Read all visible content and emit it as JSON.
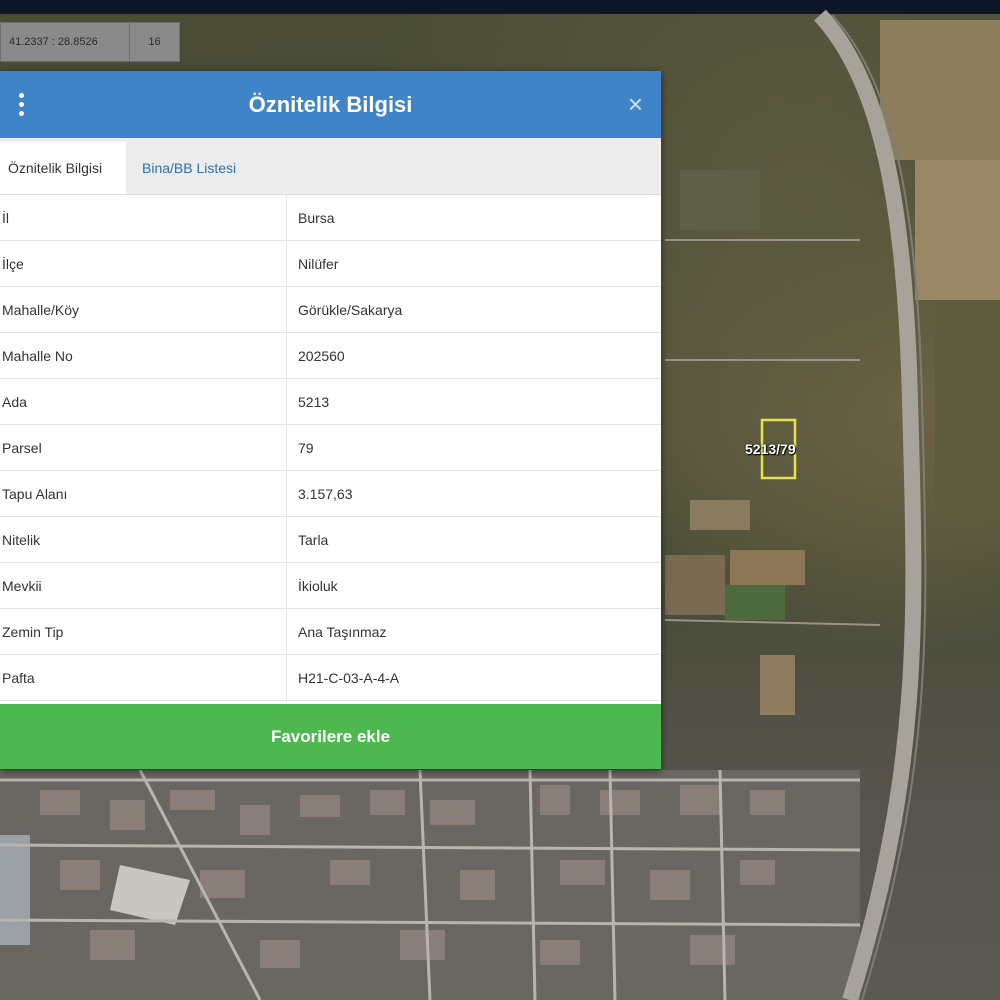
{
  "map": {
    "coordinates": "41.2337 : 28.8526",
    "zoom": "16",
    "parcel_label": "5213/79"
  },
  "panel": {
    "title": "Öznitelik Bilgisi",
    "tabs": [
      {
        "label": "Öznitelik Bilgisi",
        "active": true
      },
      {
        "label": "Bina/BB Listesi",
        "active": false
      }
    ],
    "rows": [
      {
        "key": "İl",
        "value": "Bursa"
      },
      {
        "key": "İlçe",
        "value": "Nilüfer"
      },
      {
        "key": "Mahalle/Köy",
        "value": "Görükle/Sakarya"
      },
      {
        "key": "Mahalle No",
        "value": "202560"
      },
      {
        "key": "Ada",
        "value": "5213"
      },
      {
        "key": "Parsel",
        "value": "79"
      },
      {
        "key": "Tapu Alanı",
        "value": "3.157,63"
      },
      {
        "key": "Nitelik",
        "value": "Tarla"
      },
      {
        "key": "Mevkii",
        "value": "İkioluk"
      },
      {
        "key": "Zemin Tip",
        "value": "Ana Taşınmaz"
      },
      {
        "key": "Pafta",
        "value": "H21-C-03-A-4-A"
      }
    ],
    "favorite_button": "Favorilere ekle"
  },
  "colors": {
    "header": "#3f84c8",
    "favorite": "#4cb84f"
  }
}
